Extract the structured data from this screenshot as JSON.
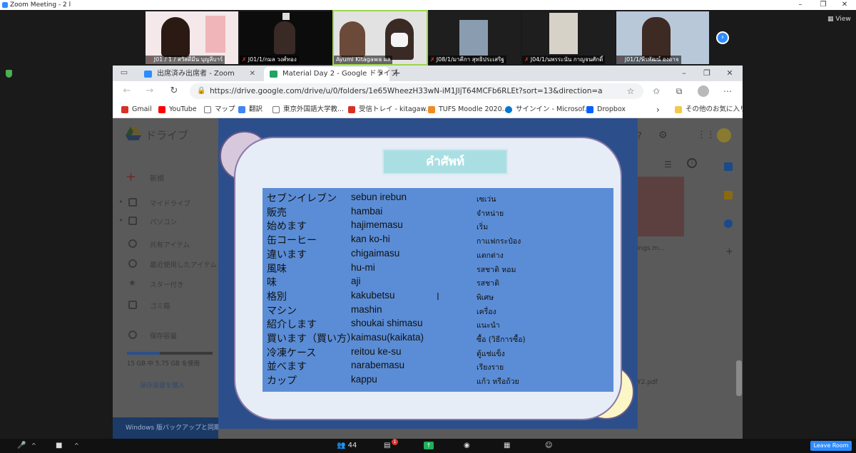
{
  "zoom": {
    "window_title": "Zoom Meeting - 2 l",
    "view_label": "View",
    "participants": [
      {
        "name": "J01 / 1 / สวัสดีมีน บุญลีบาร์",
        "active": false
      },
      {
        "name": "J01/1/กมล วงศ์ทอง",
        "active": false
      },
      {
        "name": "Ayumi Kitagawa ผล",
        "active": true
      },
      {
        "name": "J08/1/มาคีกา สุทธิประเสริฐ",
        "active": false
      },
      {
        "name": "J04/1/นพรระนัน กาญจนศักดิ์",
        "active": false
      },
      {
        "name": "J01/1/พีรพัฒน์ องอาจ",
        "active": false
      }
    ],
    "participant_count": "44",
    "chat_unread": "1",
    "leave_label": "Leave Room"
  },
  "browser": {
    "tabs": [
      {
        "label": "出席済み出席者 - Zoom",
        "active": false,
        "color": "#2d8cff"
      },
      {
        "label": "Material Day 2 - Google ドライブ",
        "active": true,
        "color": "#1fa463"
      }
    ],
    "url": "https://drive.google.com/drive/u/0/folders/1e65WheezH33wN-iM1JIjT64MCFb6RLEt?sort=13&direction=a",
    "bookmarks": [
      {
        "label": "Gmail",
        "color": "#d93025"
      },
      {
        "label": "YouTube",
        "color": "#ff0000"
      },
      {
        "label": "マップ",
        "color": "#777777"
      },
      {
        "label": "翻訳",
        "color": "#4285f4"
      },
      {
        "label": "東京外国語大学教...",
        "color": "#777777"
      },
      {
        "label": "受信トレイ - kitagaw...",
        "color": "#d93025"
      },
      {
        "label": "TUFS Moodle 2020...",
        "color": "#f08a24"
      },
      {
        "label": "サインイン - Microsof...",
        "color": "#0078d4"
      },
      {
        "label": "Dropbox",
        "color": "#0061ff"
      }
    ],
    "other_bookmarks": "その他のお気に入り"
  },
  "drive": {
    "logo_text": "ドライブ",
    "new_label": "新規",
    "nav": [
      "マイドライブ",
      "パソコン",
      "共有アイテム",
      "最近使用したアイテム",
      "スター付き",
      "ゴミ箱"
    ],
    "storage_label": "保存容量",
    "storage_used_fraction": 0.38,
    "storage_text": "15 GB 中 5.75 GB を使用",
    "buy_storage": "保存容量を購入",
    "backup_banner": "Windows 版バックアップと同期",
    "thumb_label": "ings.m...",
    "pdf_label": "Y2.pdf"
  },
  "slide": {
    "title": "คำศัพท์",
    "vocab": [
      {
        "jp": "セブンイレブン",
        "romaji": "sebun irebun",
        "thai": "เซเว่น"
      },
      {
        "jp": "販売",
        "romaji": "hambai",
        "thai": "จำหน่าย"
      },
      {
        "jp": "始めます",
        "romaji": "hajimemasu",
        "thai": "เริ่ม"
      },
      {
        "jp": "缶コーヒー",
        "romaji": "kan ko-hi",
        "thai": "กาแฟกระป๋อง"
      },
      {
        "jp": "違います",
        "romaji": "chigaimasu",
        "thai": "แตกต่าง"
      },
      {
        "jp": "風味",
        "romaji": "hu-mi",
        "thai": "รสชาติ หอม"
      },
      {
        "jp": "味",
        "romaji": " aji",
        "thai": "รสชาติ"
      },
      {
        "jp": "格別",
        "romaji": "kakubetsu",
        "thai": "พิเศษ"
      },
      {
        "jp": "マシン",
        "romaji": " mashin",
        "thai": "เครื่อง"
      },
      {
        "jp": "紹介します",
        "romaji": " shoukai shimasu",
        "thai": "แนะนำ"
      },
      {
        "jp": "買います（買い方）",
        "romaji": "kaimasu(kaikata)",
        "thai": "ซื้อ (วิธีการซื้อ)"
      },
      {
        "jp": "冷凍ケース",
        "romaji": "reitou ke-su",
        "thai": "ตู้แช่แข็ง"
      },
      {
        "jp": "並べます",
        "romaji": " narabemasu",
        "thai": "เรียงราย"
      },
      {
        "jp": "カップ",
        "romaji": "kappu",
        "thai": "แก้ว หรือถ้วย"
      }
    ]
  },
  "icons": {
    "search": "search-icon",
    "settings": "gear-icon",
    "help": "help-icon"
  }
}
